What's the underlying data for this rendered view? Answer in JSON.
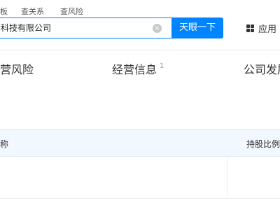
{
  "header": {
    "quick_links": [
      "板",
      "查关系",
      "查风险"
    ],
    "search": {
      "value": "科技有限公司",
      "clear_glyph": "×",
      "button_label": "天眼一下"
    },
    "apps": {
      "icon": "grid-icon",
      "label": "应用"
    }
  },
  "tabs": [
    {
      "label": "营风险",
      "count": ""
    },
    {
      "label": "经营信息",
      "count": "1"
    },
    {
      "label": "公司发展",
      "count": ""
    }
  ],
  "table": {
    "columns": [
      "称",
      "持股比例"
    ]
  }
}
